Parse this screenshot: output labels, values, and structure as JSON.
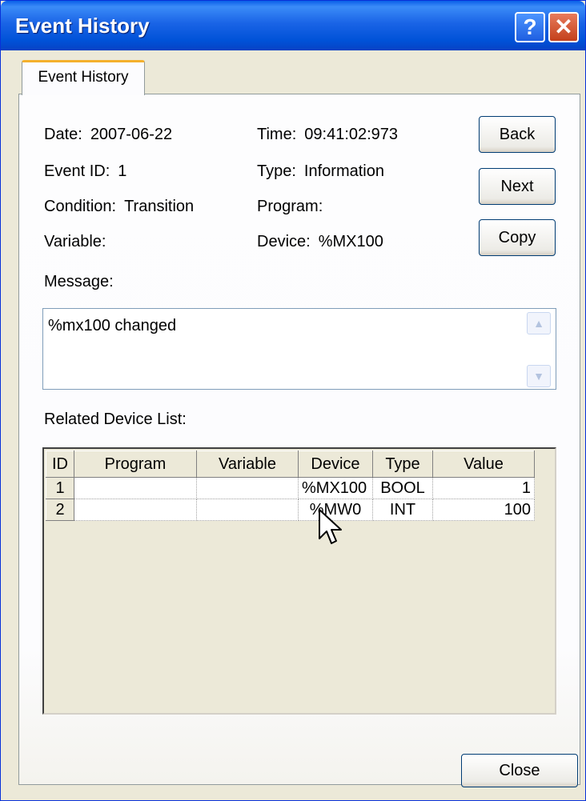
{
  "window": {
    "title": "Event History"
  },
  "tab": {
    "label": "Event History"
  },
  "info": {
    "date_label": "Date:",
    "date_value": "2007-06-22",
    "time_label": "Time:",
    "time_value": "09:41:02:973",
    "event_id_label": "Event ID:",
    "event_id_value": "1",
    "type_label": "Type:",
    "type_value": "Information",
    "condition_label": "Condition:",
    "condition_value": "Transition",
    "program_label": "Program:",
    "program_value": "",
    "variable_label": "Variable:",
    "variable_value": "",
    "device_label": "Device:",
    "device_value": "%MX100"
  },
  "buttons": {
    "back": "Back",
    "next": "Next",
    "copy": "Copy",
    "close": "Close"
  },
  "message": {
    "label": "Message:",
    "text": "%mx100 changed"
  },
  "related": {
    "label": "Related Device List:",
    "columns": [
      "ID",
      "Program",
      "Variable",
      "Device",
      "Type",
      "Value"
    ],
    "rows": [
      {
        "id": "1",
        "program": "",
        "variable": "",
        "device": "%MX100",
        "type": "BOOL",
        "value": "1"
      },
      {
        "id": "2",
        "program": "",
        "variable": "",
        "device": "%MW0",
        "type": "INT",
        "value": "100"
      }
    ]
  },
  "icons": {
    "help": "help-icon",
    "close": "close-icon",
    "cursor": "mouse-cursor-icon"
  }
}
